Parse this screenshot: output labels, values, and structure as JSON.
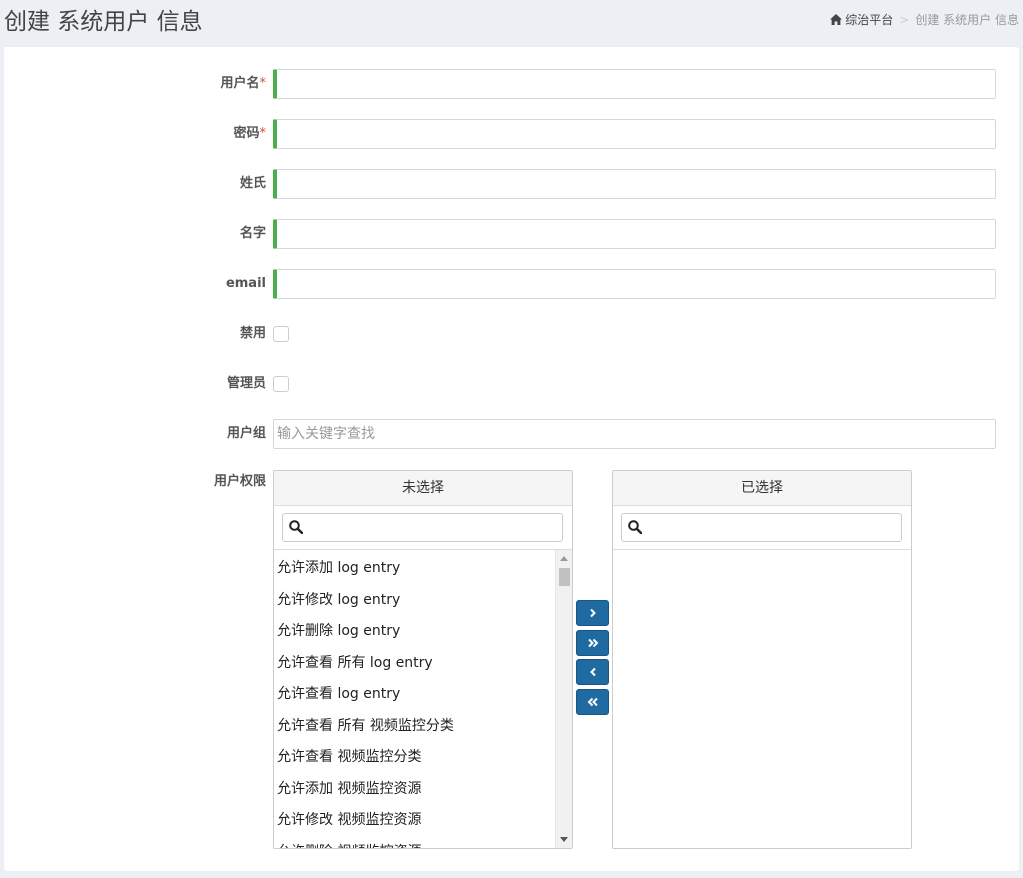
{
  "header": {
    "title": "创建 系统用户 信息",
    "breadcrumb": {
      "home": "综治平台",
      "separator": ">",
      "current": "创建 系统用户 信息"
    }
  },
  "form": {
    "username": {
      "label": "用户名",
      "required_mark": "*",
      "value": ""
    },
    "password": {
      "label": "密码",
      "required_mark": "*",
      "value": ""
    },
    "last_name": {
      "label": "姓氏",
      "value": ""
    },
    "first_name": {
      "label": "名字",
      "value": ""
    },
    "email": {
      "label": "email",
      "value": ""
    },
    "disabled": {
      "label": "禁用",
      "checked": false
    },
    "admin": {
      "label": "管理员",
      "checked": false
    },
    "user_group": {
      "label": "用户组",
      "placeholder": "输入关键字查找",
      "value": ""
    },
    "permissions": {
      "label": "用户权限"
    }
  },
  "selector": {
    "available": {
      "title": "未选择",
      "filter_value": "",
      "options": [
        "允许添加 log entry",
        "允许修改 log entry",
        "允许删除 log entry",
        "允许查看 所有 log entry",
        "允许查看 log entry",
        "允许查看 所有 视频监控分类",
        "允许查看 视频监控分类",
        "允许添加 视频监控资源",
        "允许修改 视频监控资源",
        "允许删除 视频监控资源"
      ]
    },
    "chosen": {
      "title": "已选择",
      "filter_value": "",
      "options": []
    },
    "buttons": {
      "add": "chevron-right-icon",
      "add_all": "double-chevron-right-icon",
      "remove": "chevron-left-icon",
      "remove_all": "double-chevron-left-icon"
    }
  },
  "colors": {
    "page_bg": "#ecf0f5",
    "accent_border": "#4cae4c",
    "required": "#dd4b39",
    "button_blue": "#1f6aa0"
  }
}
